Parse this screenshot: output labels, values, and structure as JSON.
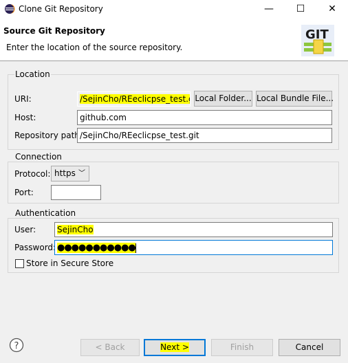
{
  "window": {
    "title": "Clone Git Repository",
    "minimize_glyph": "—",
    "maximize_glyph": "☐",
    "close_glyph": "✕"
  },
  "banner": {
    "title": "Source Git Repository",
    "description": "Enter the location of the source repository.",
    "logo_text": "GIT"
  },
  "location": {
    "group_title": "Location",
    "uri_label": "URI:",
    "uri_value": "/SejinCho/REeclicpse_test.git",
    "local_folder_button": "Local Folder...",
    "local_bundle_button": "Local Bundle File...",
    "host_label": "Host:",
    "host_value": "github.com",
    "repo_path_label": "Repository path:",
    "repo_path_value": "/SejinCho/REeclicpse_test.git"
  },
  "connection": {
    "group_title": "Connection",
    "protocol_label": "Protocol:",
    "protocol_value": "https",
    "port_label": "Port:",
    "port_value": ""
  },
  "authentication": {
    "group_title": "Authentication",
    "user_label": "User:",
    "user_value": "SejinCho",
    "password_label": "Password:",
    "password_value": "●●●●●●●●●●●",
    "secure_store_label": "Store in Secure Store",
    "secure_store_checked": false
  },
  "footer": {
    "back_label": "< Back",
    "next_label": "Next >",
    "finish_label": "Finish",
    "cancel_label": "Cancel"
  },
  "colors": {
    "highlight": "#ffff00",
    "default_button_border": "#0078d7",
    "disabled_text": "#a0a0a0"
  },
  "icons": {
    "app": "eclipse-icon",
    "help": "help-icon",
    "logo": "git-logo-icon"
  }
}
